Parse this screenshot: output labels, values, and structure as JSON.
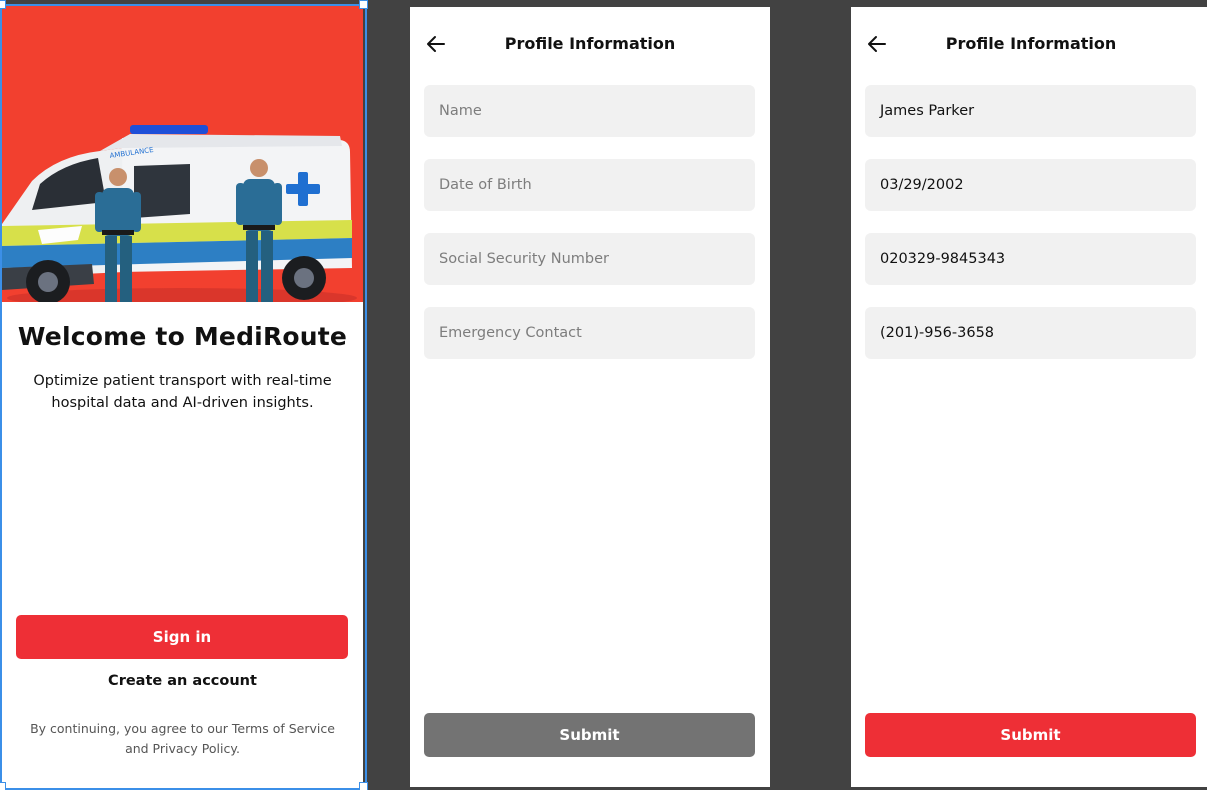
{
  "colors": {
    "canvas_bg": "#424242",
    "accent_red": "#ee2f36",
    "hero_bg": "#f2402f",
    "disabled_button": "#737373",
    "field_bg": "#f1f1f1",
    "selection_blue": "#3b8fe8"
  },
  "welcome": {
    "hero_image": "ambulance-with-paramedics",
    "title": "Welcome to MediRoute",
    "subtitle": "Optimize patient transport with real-time hospital data and AI-driven insights.",
    "sign_in_label": "Sign in",
    "create_account_label": "Create an account",
    "legal_text": "By continuing, you agree to our Terms of Service and Privacy Policy.",
    "ambulance_text": "AMBULANCE"
  },
  "profile_empty": {
    "back_icon": "arrow-left-icon",
    "title": "Profile Information",
    "fields": [
      {
        "placeholder": "Name",
        "value": ""
      },
      {
        "placeholder": "Date of Birth",
        "value": ""
      },
      {
        "placeholder": "Social Security Number",
        "value": ""
      },
      {
        "placeholder": "Emergency Contact",
        "value": ""
      }
    ],
    "submit_label": "Submit",
    "submit_state": "disabled"
  },
  "profile_filled": {
    "back_icon": "arrow-left-icon",
    "title": "Profile Information",
    "fields": [
      {
        "placeholder": "Name",
        "value": "James Parker"
      },
      {
        "placeholder": "Date of Birth",
        "value": "03/29/2002"
      },
      {
        "placeholder": "Social Security Number",
        "value": "020329-9845343"
      },
      {
        "placeholder": "Emergency Contact",
        "value": "(201)-956-3658"
      }
    ],
    "submit_label": "Submit",
    "submit_state": "enabled"
  }
}
